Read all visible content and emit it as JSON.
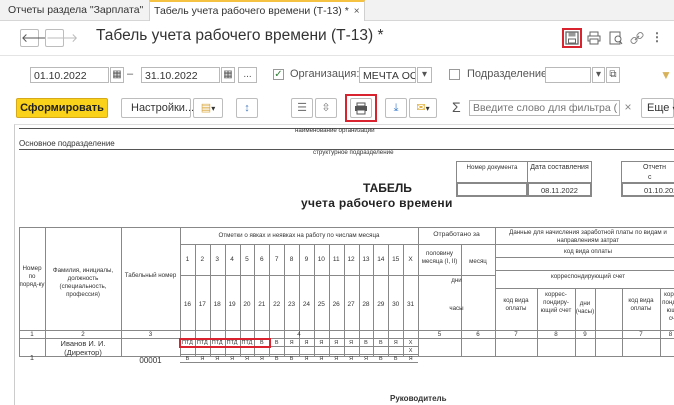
{
  "tabs": [
    {
      "label": "Отчеты раздела \"Зарплата\"",
      "close": "×"
    },
    {
      "label": "Табель учета рабочего времени (Т-13) *",
      "close": "×"
    }
  ],
  "header": {
    "title": "Табель учета рабочего времени (Т-13) *",
    "more": "⋮"
  },
  "filters": {
    "date_from": "01.10.2022",
    "dash": "–",
    "date_to": "31.10.2022",
    "period_button": "...",
    "org_label": "Организация:",
    "org_value": "МЕЧТА ООО",
    "dept_label": "Подразделение:",
    "dept_value": ""
  },
  "toolbar": {
    "generate": "Сформировать",
    "settings": "Настройки...",
    "search_placeholder": "Введите слово для фильтра (...",
    "sum": "Σ",
    "more": "Еще"
  },
  "document": {
    "org_caption": "наименование организации",
    "dept_value": "Основное подразделение",
    "dept_caption": "структурное подразделение",
    "doc_number_hdr": "Номер документа",
    "doc_date_hdr": "Дата составления",
    "doc_date": "08.11.2022",
    "period_hdr": "Отчетн",
    "period_from": "с",
    "period_date": "01.10.202",
    "title1": "ТАБЕЛЬ",
    "title2": "учета  рабочего времени",
    "col_num": "Номер по поряд-ку",
    "col_name": "Фамилия, инициалы, должность (специальность, профессия)",
    "col_tab": "Табельный номер",
    "col_marks": "Отметки о явках и неявках на работу по числам месяца",
    "col_worked": "Отработано за",
    "col_half": "половину месяца (I, II)",
    "col_month": "месяц",
    "col_days": "дни",
    "col_hours": "часы",
    "col_payroll": "Данные для начисления заработной платы по видам и направлениям затрат",
    "col_pay_code": "код вида оплаты",
    "col_corr": "корреспондирующий счет",
    "sub_pay_code": "код вида оплаты",
    "sub_corr": "коррес-пондиру-ющий счет",
    "sub_days": "дни (часы)",
    "days_row1": [
      "1",
      "2",
      "3",
      "4",
      "5",
      "6",
      "7",
      "8",
      "9",
      "10",
      "11",
      "12",
      "13",
      "14",
      "15",
      "X"
    ],
    "days_row2": [
      "16",
      "17",
      "18",
      "19",
      "20",
      "21",
      "22",
      "23",
      "24",
      "25",
      "26",
      "27",
      "28",
      "29",
      "30",
      "31"
    ],
    "col_numbers": [
      "1",
      "2",
      "3",
      "4",
      "5",
      "6",
      "7",
      "8",
      "9",
      "7",
      "8"
    ],
    "employee": {
      "num": "1",
      "name": "Иванов И. И.",
      "position": "(Директор)",
      "tab": "00001",
      "marks_row1": [
        "ПТД",
        "ПТД",
        "ПТД",
        "ПТД",
        "ПТД",
        "В",
        "В",
        "Я",
        "Я",
        "Я",
        "Я",
        "Я",
        "В",
        "В",
        "Я",
        "X"
      ],
      "marks_row3": [
        "В",
        "Я",
        "Я",
        "Я",
        "Я",
        "Я",
        "В",
        "В",
        "Я",
        "Я",
        "Я",
        "Я",
        "Я",
        "В",
        "В",
        "Я"
      ]
    },
    "footer": "Руководитель"
  },
  "colors": {
    "accent": "#fbd21a",
    "highlight": "#d9232e",
    "tab_accent": "#f5c242"
  }
}
